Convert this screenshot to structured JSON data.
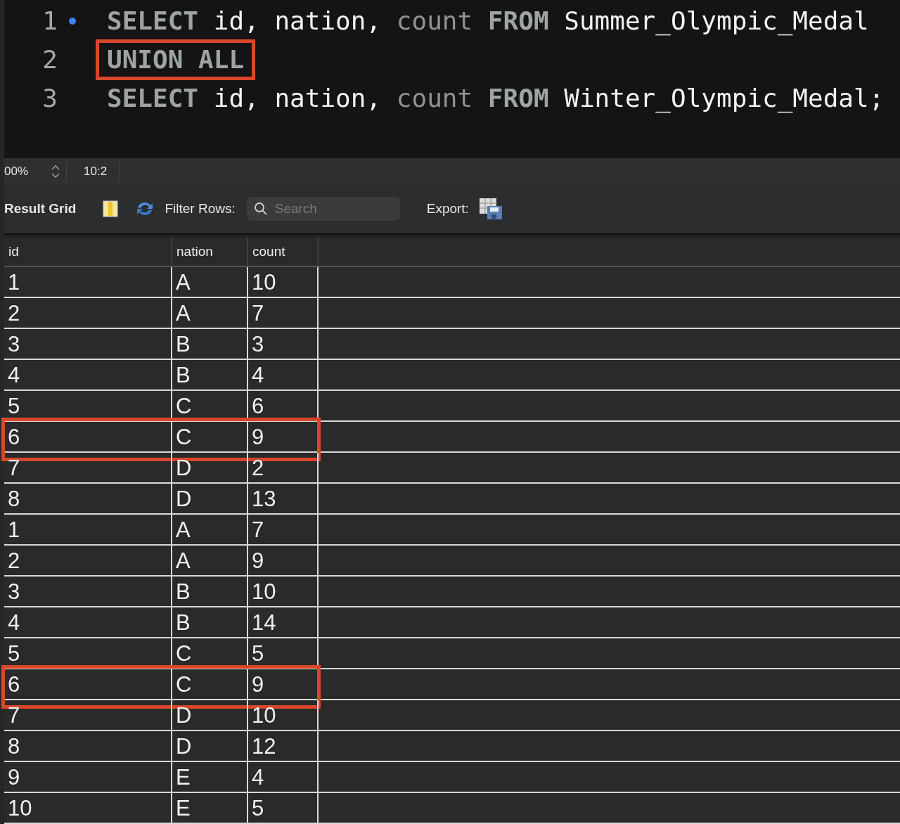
{
  "editor": {
    "lines": [
      {
        "number": "1",
        "has_dot": true,
        "highlighted": false,
        "tokens": [
          {
            "text": "SELECT",
            "kind": "keyword"
          },
          {
            "text": " id, nation, ",
            "kind": "identifier"
          },
          {
            "text": "count ",
            "kind": "function"
          },
          {
            "text": "FROM",
            "kind": "keyword"
          },
          {
            "text": " Summer_Olympic_Medal",
            "kind": "identifier"
          }
        ]
      },
      {
        "number": "2",
        "has_dot": false,
        "highlighted": true,
        "tokens": [
          {
            "text": "UNION ALL",
            "kind": "keyword"
          }
        ]
      },
      {
        "number": "3",
        "has_dot": false,
        "highlighted": false,
        "tokens": [
          {
            "text": "SELECT",
            "kind": "keyword"
          },
          {
            "text": " id, nation, ",
            "kind": "identifier"
          },
          {
            "text": "count ",
            "kind": "function"
          },
          {
            "text": "FROM",
            "kind": "keyword"
          },
          {
            "text": " Winter_Olympic_Medal;",
            "kind": "identifier"
          }
        ]
      }
    ]
  },
  "status_bar": {
    "zoom": "00%",
    "cursor": "10:2"
  },
  "toolbar": {
    "title": "Result Grid",
    "filter_label": "Filter Rows:",
    "search": {
      "placeholder": "Search"
    },
    "export_label": "Export:"
  },
  "table": {
    "columns": [
      "id",
      "nation",
      "count"
    ],
    "rows": [
      {
        "cells": [
          "1",
          "A",
          "10"
        ],
        "highlighted": false
      },
      {
        "cells": [
          "2",
          "A",
          "7"
        ],
        "highlighted": false
      },
      {
        "cells": [
          "3",
          "B",
          "3"
        ],
        "highlighted": false
      },
      {
        "cells": [
          "4",
          "B",
          "4"
        ],
        "highlighted": false
      },
      {
        "cells": [
          "5",
          "C",
          "6"
        ],
        "highlighted": false
      },
      {
        "cells": [
          "6",
          "C",
          "9"
        ],
        "highlighted": true
      },
      {
        "cells": [
          "7",
          "D",
          "2"
        ],
        "highlighted": false
      },
      {
        "cells": [
          "8",
          "D",
          "13"
        ],
        "highlighted": false
      },
      {
        "cells": [
          "1",
          "A",
          "7"
        ],
        "highlighted": false
      },
      {
        "cells": [
          "2",
          "A",
          "9"
        ],
        "highlighted": false
      },
      {
        "cells": [
          "3",
          "B",
          "10"
        ],
        "highlighted": false
      },
      {
        "cells": [
          "4",
          "B",
          "14"
        ],
        "highlighted": false
      },
      {
        "cells": [
          "5",
          "C",
          "5"
        ],
        "highlighted": false
      },
      {
        "cells": [
          "6",
          "C",
          "9"
        ],
        "highlighted": true
      },
      {
        "cells": [
          "7",
          "D",
          "10"
        ],
        "highlighted": false
      },
      {
        "cells": [
          "8",
          "D",
          "12"
        ],
        "highlighted": false
      },
      {
        "cells": [
          "9",
          "E",
          "4"
        ],
        "highlighted": false
      },
      {
        "cells": [
          "10",
          "E",
          "5"
        ],
        "highlighted": false
      }
    ]
  }
}
